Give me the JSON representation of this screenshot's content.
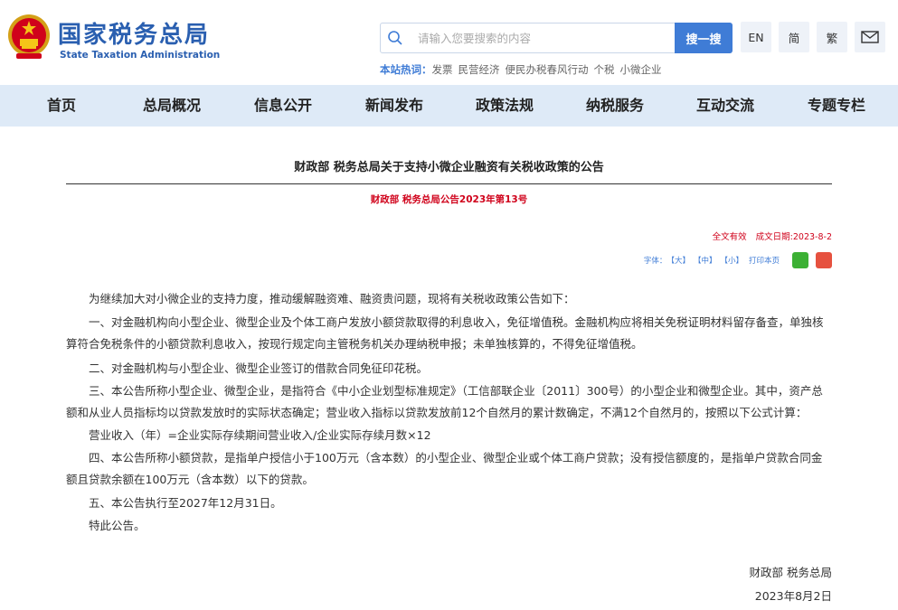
{
  "header": {
    "logo_cn": "国家税务总局",
    "logo_en": "State Taxation Administration",
    "search": {
      "placeholder": "请输入您要搜索的内容",
      "button": "搜一搜"
    },
    "lang_buttons": [
      "EN",
      "简",
      "繁"
    ],
    "hot": {
      "label": "本站热词：",
      "items": [
        "发票",
        "民营经济",
        "便民办税春风行动",
        "个税",
        "小微企业"
      ]
    }
  },
  "nav": {
    "items": [
      "首页",
      "总局概况",
      "信息公开",
      "新闻发布",
      "政策法规",
      "纳税服务",
      "互动交流",
      "专题专栏"
    ]
  },
  "article": {
    "title": "财政部 税务总局关于支持小微企业融资有关税收政策的公告",
    "doc_no": "财政部 税务总局公告2023年第13号",
    "status": "全文有效",
    "date_label": "成文日期:2023-8-2",
    "font_label": "字体：",
    "font_sizes": [
      "【大】",
      "【中】",
      "【小】"
    ],
    "print": "打印本页",
    "paragraphs": [
      "为继续加大对小微企业的支持力度，推动缓解融资难、融资贵问题，现将有关税收政策公告如下：",
      "一、对金融机构向小型企业、微型企业及个体工商户发放小额贷款取得的利息收入，免征增值税。金融机构应将相关免税证明材料留存备查，单独核算符合免税条件的小额贷款利息收入，按现行规定向主管税务机关办理纳税申报；未单独核算的，不得免征增值税。",
      "二、对金融机构与小型企业、微型企业签订的借款合同免征印花税。",
      "三、本公告所称小型企业、微型企业，是指符合《中小企业划型标准规定》（工信部联企业〔2011〕300号）的小型企业和微型企业。其中，资产总额和从业人员指标均以贷款发放时的实际状态确定；营业收入指标以贷款发放前12个自然月的累计数确定，不满12个自然月的，按照以下公式计算：",
      "营业收入（年）=企业实际存续期间营业收入/企业实际存续月数×12",
      "四、本公告所称小额贷款，是指单户授信小于100万元（含本数）的小型企业、微型企业或个体工商户贷款；没有授信额度的，是指单户贷款合同金额且贷款余额在100万元（含本数）以下的贷款。",
      "五、本公告执行至2027年12月31日。",
      "特此公告。"
    ],
    "signer": "财政部 税务总局",
    "sign_date": "2023年8月2日"
  }
}
